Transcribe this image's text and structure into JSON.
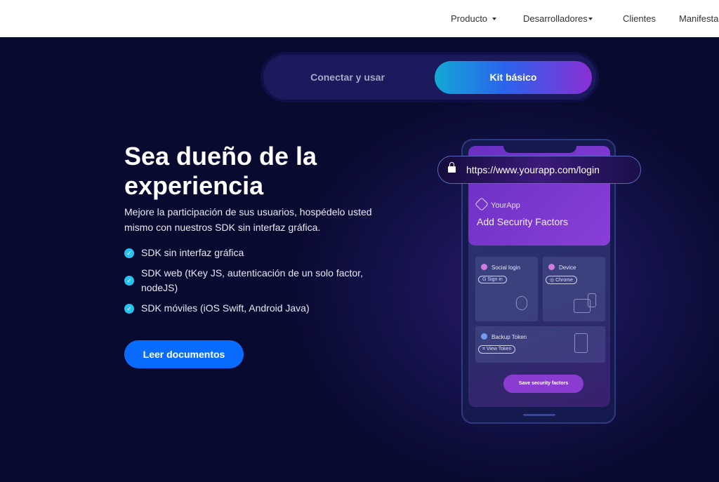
{
  "nav": {
    "items": [
      {
        "label": "Producto",
        "dropdown": true
      },
      {
        "label": "Desarrolladores",
        "dropdown": true
      },
      {
        "label": "Clientes"
      },
      {
        "label": "Manifesta"
      }
    ]
  },
  "toggle": {
    "options": [
      "Conectar y usar",
      "Kit básico"
    ],
    "selected": "Kit básico"
  },
  "hero": {
    "title": "Sea dueño de la experiencia",
    "description": "Mejore la participación de sus usuarios, hospédelo usted mismo con nuestros SDK sin interfaz gráfica.",
    "features": [
      "SDK sin interfaz gráfica",
      "SDK web (tKey JS, autenticación de un solo factor, nodeJS)",
      "SDK móviles (iOS Swift, Android Java)"
    ],
    "cta": "Leer documentos"
  },
  "mockup": {
    "url": "https://www.yourapp.com/login",
    "brand": "YourApp",
    "title": "Add Security Factors",
    "cards": [
      {
        "title": "Social login",
        "pill": "Sign in"
      },
      {
        "title": "Device",
        "pill": "Chrome"
      },
      {
        "title": "Backup Token",
        "pill": "View Token"
      }
    ],
    "save": "Save security factors"
  },
  "colors": {
    "background": "#090a30",
    "cta": "#0a6cff",
    "check": "#29c1f0",
    "accent": "#8a3bd0"
  }
}
